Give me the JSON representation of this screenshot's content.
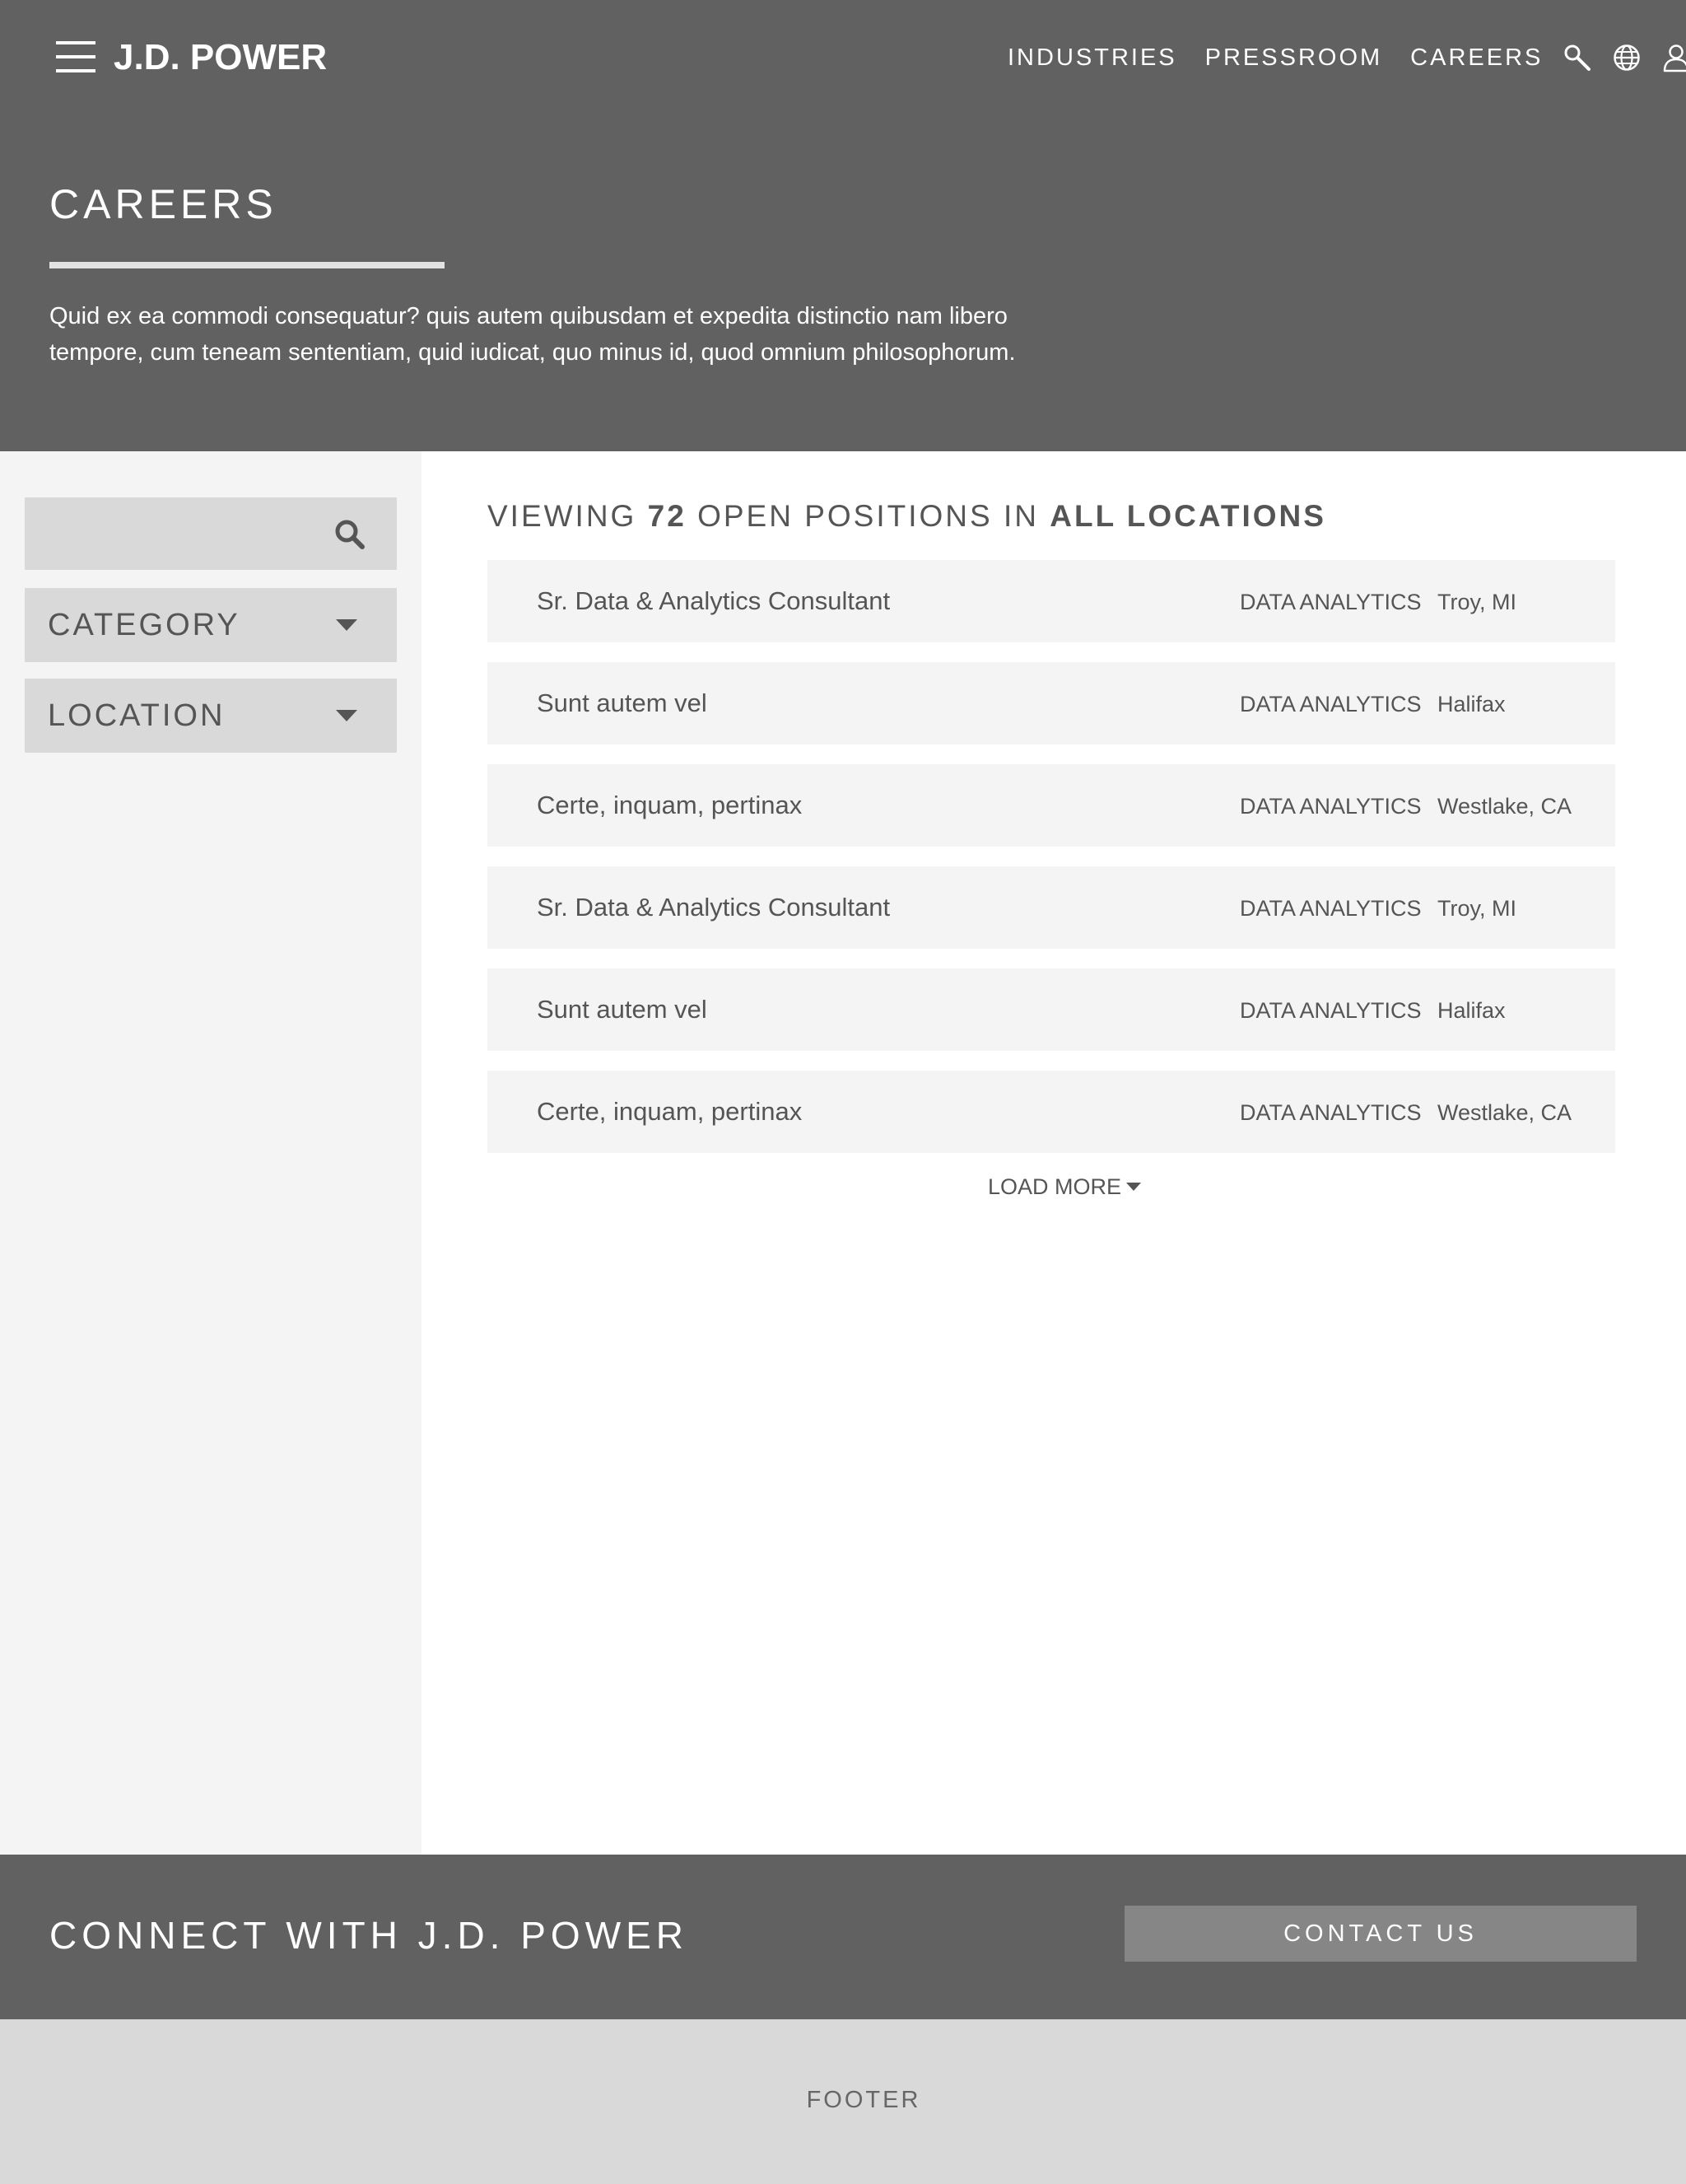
{
  "header": {
    "logo": "J.D. POWER",
    "nav": [
      {
        "label": "INDUSTRIES"
      },
      {
        "label": "PRESSROOM"
      },
      {
        "label": "CAREERS"
      }
    ],
    "icons": [
      "search-icon",
      "globe-icon",
      "user-icon"
    ]
  },
  "hero": {
    "title": "CAREERS",
    "intro": "Quid ex ea commodi consequatur? quis autem quibusdam et expedita distinctio nam libero tempore, cum teneam sententiam, quid iudicat, quo minus id, quod omnium philosophorum."
  },
  "sidebar": {
    "search": {
      "value": "",
      "placeholder": ""
    },
    "filters": [
      {
        "label": "CATEGORY"
      },
      {
        "label": "LOCATION"
      }
    ]
  },
  "results": {
    "prefix": "VIEWING",
    "count": "72",
    "middle": "OPEN POSITIONS IN",
    "scope": "ALL LOCATIONS",
    "jobs": [
      {
        "title": "Sr. Data & Analytics Consultant",
        "category": "DATA ANALYTICS",
        "location": "Troy, MI"
      },
      {
        "title": "Sunt autem vel",
        "category": "DATA ANALYTICS",
        "location": "Halifax"
      },
      {
        "title": "Certe, inquam, pertinax",
        "category": "DATA ANALYTICS",
        "location": "Westlake, CA"
      },
      {
        "title": "Sr. Data & Analytics Consultant",
        "category": "DATA ANALYTICS",
        "location": "Troy, MI"
      },
      {
        "title": "Sunt autem vel",
        "category": "DATA ANALYTICS",
        "location": "Halifax"
      },
      {
        "title": "Certe, inquam, pertinax",
        "category": "DATA ANALYTICS",
        "location": "Westlake, CA"
      }
    ],
    "load_more": "LOAD MORE"
  },
  "connect": {
    "title": "CONNECT WITH J.D. POWER",
    "button": "CONTACT US"
  },
  "footer": {
    "label": "FOOTER"
  },
  "colors": {
    "header_bg": "#616161",
    "sidebar_bg": "#f4f4f4",
    "row_bg": "#f4f4f4",
    "control_bg": "#d9d9d9",
    "button_bg": "#868686",
    "text_dark": "#555555",
    "footer_bg": "#d9d9d9"
  }
}
